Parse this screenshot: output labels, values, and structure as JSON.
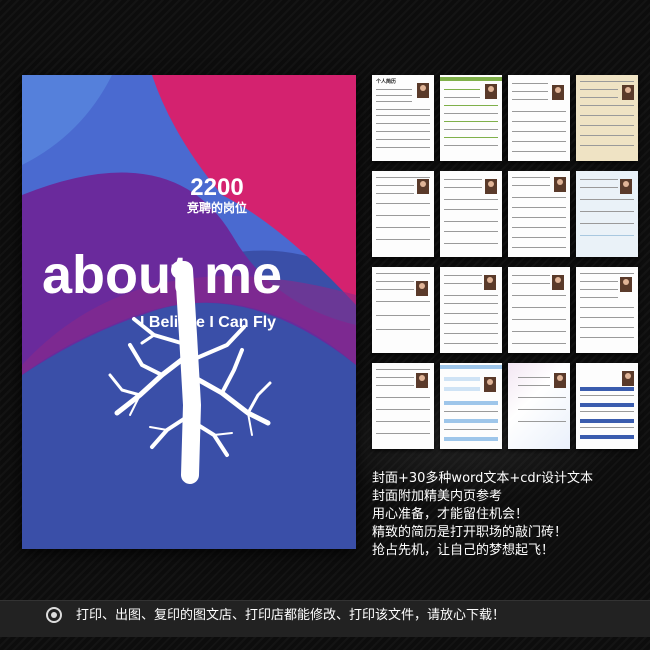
{
  "cover": {
    "number": "2200",
    "subtitle": "竞聘的岗位",
    "title": "about me",
    "tagline": "I Believe I Can Fly"
  },
  "thumbnails": {
    "first_title": "个人简历"
  },
  "promo": {
    "lines": [
      "封面+30多种word文本+cdr设计文本",
      "封面附加精美内页参考",
      "用心准备，才能留住机会！",
      "精致的简历是打开职场的敲门砖！",
      "抢占先机，让自己的梦想起飞！"
    ]
  },
  "footer": {
    "icon": "bullet-circle-icon",
    "text": "打印、出图、复印的图文店、打印店都能修改、打印该文件，请放心下载！"
  },
  "colors": {
    "cover_blue": "#3a4fa8",
    "cover_magenta": "#d4226f",
    "cover_purple": "#6a2a9c"
  }
}
